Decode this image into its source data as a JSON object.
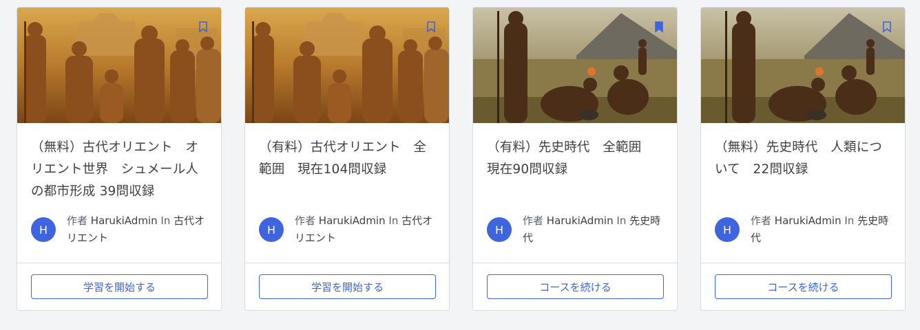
{
  "colors": {
    "accent": "#3e64de",
    "border": "#d8dbe0",
    "text": "#41403e",
    "background": "#f3f4f6"
  },
  "cards": [
    {
      "image": "ancient-mesopotamia-illustration",
      "bookmark_icon": "bookmark-outline-icon",
      "title": "（無料）古代オリエント　オリエント世界　シュメール人の都市形成 39問収録",
      "avatar_initial": "H",
      "by_label": "作者",
      "author": "HarukiAdmin",
      "in_label": "In",
      "category": "古代オリエント",
      "button_label": "学習を開始する"
    },
    {
      "image": "ancient-mesopotamia-illustration",
      "bookmark_icon": "bookmark-outline-icon",
      "title": "（有料）古代オリエント　全範囲　現在104問収録",
      "avatar_initial": "H",
      "by_label": "作者",
      "author": "HarukiAdmin",
      "in_label": "In",
      "category": "古代オリエント",
      "button_label": "学習を開始する"
    },
    {
      "image": "prehistoric-humans-illustration",
      "bookmark_icon": "bookmark-filled-icon",
      "title": "（有料）先史時代　全範囲　現在90問収録",
      "avatar_initial": "H",
      "by_label": "作者",
      "author": "HarukiAdmin",
      "in_label": "In",
      "category": "先史時代",
      "button_label": "コースを続ける"
    },
    {
      "image": "prehistoric-humans-illustration",
      "bookmark_icon": "bookmark-outline-icon",
      "title": "（無料）先史時代　人類について　22問収録",
      "avatar_initial": "H",
      "by_label": "作者",
      "author": "HarukiAdmin",
      "in_label": "In",
      "category": "先史時代",
      "button_label": "コースを続ける"
    }
  ]
}
